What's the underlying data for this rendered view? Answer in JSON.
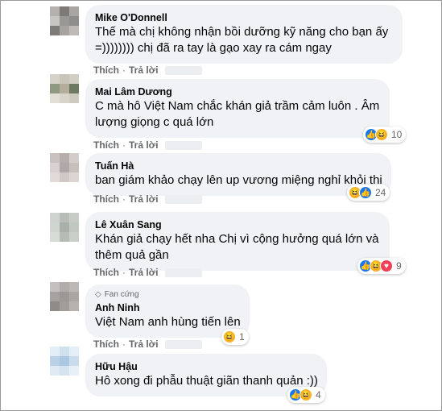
{
  "labels": {
    "like": "Thích",
    "reply": "Trả lời",
    "dot": "·"
  },
  "comments": [
    {
      "name": "Mike O'Donnell",
      "lines": [
        "Thế mà chị không nhận bồi dưỡng kỹ năng cho bạn ấy",
        "=)))))))) chị đã ra tay là gạo xay ra cám ngay"
      ],
      "avatar": [
        "#b3b0ad",
        "#7c7b78",
        "#a9a5a3",
        "#c8c6c3",
        "#9a9895",
        "#8f8d8b",
        "#7d7c79",
        "#a6a4a1",
        "#bdbab7"
      ]
    },
    {
      "name": "Mai Lâm Dương",
      "lines": [
        "C mà hô Việt Nam chắc khán giả trầm cảm luôn . Âm",
        "lượng giọng c quá lớn"
      ],
      "reactions": [
        "like-icon",
        "haha-icon"
      ],
      "count": "10",
      "avatar": [
        "#d6d2c9",
        "#c9c4b8",
        "#d3cec3",
        "#8f9880",
        "#b3ad99",
        "#6d7a61",
        "#e3dfd6",
        "#d9d4ca",
        "#cfcabe"
      ]
    },
    {
      "name": "Tuấn Hà",
      "lines": [
        "ban giám khảo chạy lên up vương miệng nghỉ khỏi thi"
      ],
      "reactions": [
        "haha-icon",
        "like-icon"
      ],
      "count": "24",
      "avatar": [
        "#c9c2c0",
        "#b4adac",
        "#d3cdca",
        "#d8d1cf",
        "#b0a8a8",
        "#c6bfbc",
        "#e0dad8",
        "#cfc8c6",
        "#dcd6d3"
      ]
    },
    {
      "name": "Lê Xuân Sang",
      "lines": [
        "Khán giả chạy hết nha Chị vì cộng hưởng quá lớn và",
        "thêm quả gần"
      ],
      "reactions": [
        "like-icon",
        "haha-icon",
        "love-icon"
      ],
      "count": "9",
      "avatar": [
        "#d0d4d0",
        "#b8bdb8",
        "#c7ccc7",
        "#cfd5cf",
        "#a9b0a9",
        "#c1c7c1",
        "#d7dcd7",
        "#b5bbb5",
        "#c9cec9"
      ]
    },
    {
      "name": "Anh Ninh",
      "badge": "Fan cứng",
      "lines": [
        "Việt Nam anh hùng tiến lên"
      ],
      "reactions": [
        "haha-icon"
      ],
      "count": "1",
      "avatar": [
        "#c4c0bf",
        "#b1adab",
        "#bcb8b6",
        "#a6a2a0",
        "#9c9896",
        "#aaa6a4",
        "#8f8b89",
        "#a19d9b",
        "#b6b2b0"
      ]
    },
    {
      "name": "Hữu Hậu",
      "lines": [
        "Hô xong đi phẫu thuật giãn thanh quản :))"
      ],
      "reactions": [
        "like-icon",
        "haha-icon"
      ],
      "count": "4",
      "avatar": [
        "#e3eef8",
        "#cfe0ee",
        "#e6eff7",
        "#b9d2e8",
        "#aac8e2",
        "#c8dcec",
        "#dfe9f2",
        "#d4e3ef",
        "#e8f0f7"
      ]
    }
  ]
}
